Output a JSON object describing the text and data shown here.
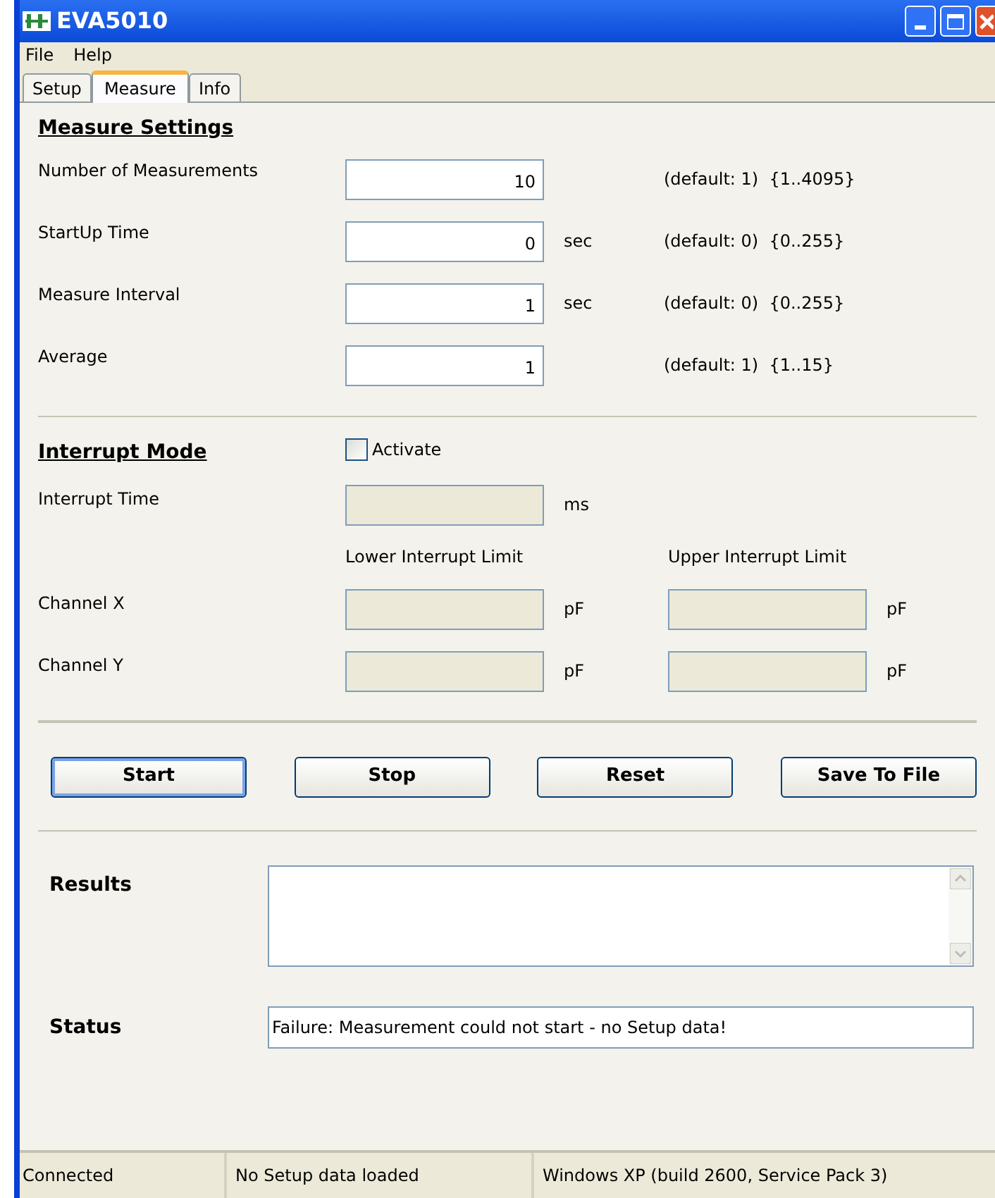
{
  "window": {
    "title": "EVA5010"
  },
  "menu": [
    "File",
    "Help"
  ],
  "tabs": [
    {
      "label": "Setup",
      "selected": false
    },
    {
      "label": "Measure",
      "selected": true
    },
    {
      "label": "Info",
      "selected": false
    }
  ],
  "measure_settings": {
    "heading": "Measure Settings",
    "rows": [
      {
        "label": "Number of Measurements",
        "value": "10",
        "hint": "(default: 1)  {1..4095}"
      },
      {
        "label": "StartUp Time",
        "value": "0",
        "unit": "sec",
        "hint": "(default: 0)  {0..255}"
      },
      {
        "label": "Measure Interval",
        "value": "1",
        "unit": "sec",
        "hint": "(default: 0)  {0..255}"
      },
      {
        "label": "Average",
        "value": "1",
        "hint": "(default: 1)  {1..15}"
      }
    ]
  },
  "interrupt_mode": {
    "heading": "Interrupt Mode",
    "activate": {
      "label": "Activate",
      "checked": false
    },
    "interrupt_time": {
      "label": "Interrupt Time",
      "unit": "ms",
      "disabled": true
    },
    "columns": [
      "Lower Interrupt Limit",
      "Upper Interrupt Limit"
    ],
    "channels": [
      {
        "label": "Channel X",
        "lower_unit": "pF",
        "upper_unit": "pF",
        "disabled": true
      },
      {
        "label": "Channel Y",
        "lower_unit": "pF",
        "upper_unit": "pF",
        "disabled": true
      }
    ]
  },
  "buttons": [
    {
      "label": "Start",
      "focused": true
    },
    {
      "label": "Stop",
      "focused": false
    },
    {
      "label": "Reset",
      "focused": false
    },
    {
      "label": "Save To File",
      "focused": false
    }
  ],
  "results": {
    "label": "Results"
  },
  "status": {
    "label": "Status",
    "value": "Failure: Measurement could not start - no Setup data!"
  },
  "status_bar": [
    "Connected",
    "No Setup data loaded",
    "Windows XP (build 2600, Service Pack 3)"
  ]
}
